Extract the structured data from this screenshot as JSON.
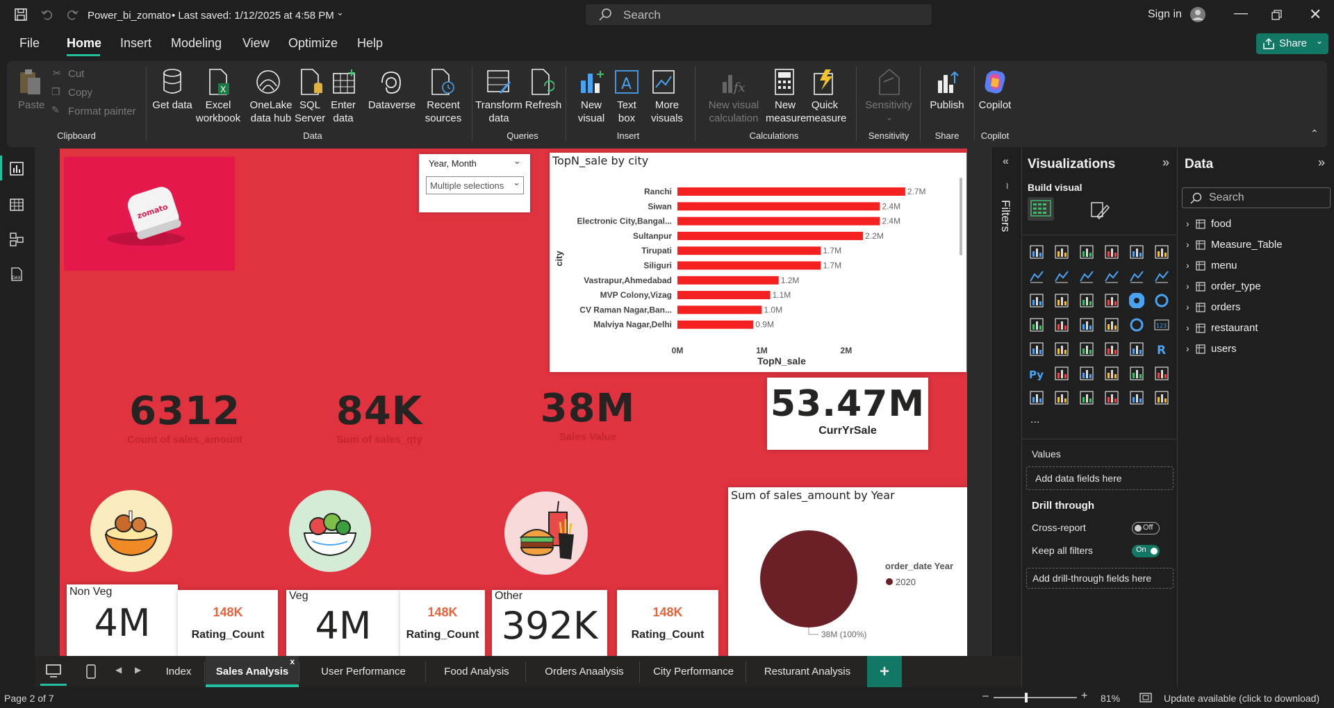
{
  "titlebar": {
    "title": "Power_bi_zomato",
    "saved": "• Last saved: 1/12/2025 at 4:58 PM",
    "search_placeholder": "Search",
    "sign_in": "Sign in"
  },
  "menu": {
    "items": [
      "File",
      "Home",
      "Insert",
      "Modeling",
      "View",
      "Optimize",
      "Help"
    ],
    "active": "Home",
    "share": "Share"
  },
  "ribbon": {
    "clipboard": {
      "paste": "Paste",
      "cut": "Cut",
      "copy": "Copy",
      "format_painter": "Format painter",
      "group": "Clipboard"
    },
    "data": {
      "items": [
        "Get data",
        "Excel workbook",
        "OneLake data hub",
        "SQL Server",
        "Enter data",
        "Dataverse",
        "Recent sources"
      ],
      "group": "Data"
    },
    "queries": {
      "items": [
        "Transform data",
        "Refresh"
      ],
      "group": "Queries"
    },
    "insert": {
      "items": [
        "New visual",
        "Text box",
        "More visuals"
      ],
      "group": "Insert"
    },
    "calculations": {
      "items": [
        "New visual calculation",
        "New measure",
        "Quick measure"
      ],
      "group": "Calculations"
    },
    "sensitivity": {
      "items": [
        "Sensitivity"
      ],
      "group": "Sensitivity"
    },
    "share": {
      "items": [
        "Publish"
      ],
      "group": "Share"
    },
    "copilot": {
      "items": [
        "Copilot"
      ],
      "group": "Copilot"
    }
  },
  "slicer": {
    "title": "Year, Month",
    "value": "Multiple selections"
  },
  "logo_text": "zomato",
  "kpis": [
    {
      "value": "6312",
      "label": "Count of sales_amount"
    },
    {
      "value": "84K",
      "label": "Sum of sales_qty"
    },
    {
      "value": "38M",
      "label": "Sales Value"
    },
    {
      "value": "53.47M",
      "label": "CurrYrSale"
    }
  ],
  "category_cards": [
    {
      "title": "Non Veg",
      "value": "4M",
      "rating": "148K",
      "rating_label": "Rating_Count"
    },
    {
      "title": "Veg",
      "value": "4M",
      "rating": "148K",
      "rating_label": "Rating_Count"
    },
    {
      "title": "Other",
      "value": "392K",
      "rating": "148K",
      "rating_label": "Rating_Count"
    }
  ],
  "chart_data": [
    {
      "type": "bar",
      "title": "TopN_sale by city",
      "xlabel": "TopN_sale",
      "ylabel": "city",
      "categories": [
        "Ranchi",
        "Siwan",
        "Electronic City,Bangal...",
        "Sultanpur",
        "Tirupati",
        "Siliguri",
        "Vastrapur,Ahmedabad",
        "MVP Colony,Vizag",
        "CV Raman Nagar,Ban...",
        "Malviya Nagar,Delhi"
      ],
      "values": [
        2.7,
        2.4,
        2.4,
        2.2,
        1.7,
        1.7,
        1.2,
        1.1,
        1.0,
        0.9
      ],
      "data_labels": [
        "2.7M",
        "2.4M",
        "2.4M",
        "2.2M",
        "1.7M",
        "1.7M",
        "1.2M",
        "1.1M",
        "1.0M",
        "0.9M"
      ],
      "xticks": [
        "0M",
        "1M",
        "2M"
      ],
      "xlim": [
        0,
        2.8
      ],
      "color": "#f52020"
    },
    {
      "type": "pie",
      "title": "Sum of sales_amount by Year",
      "legend_title": "order_date Year",
      "categories": [
        "2020"
      ],
      "values": [
        38
      ],
      "data_label": "38M (100%)",
      "color": "#6b1f26",
      "legend_position": "right"
    }
  ],
  "filters": {
    "label": "Filters"
  },
  "visualizations": {
    "title": "Visualizations",
    "build_visual": "Build visual",
    "values": "Values",
    "add_fields": "Add data fields here",
    "drill_through": "Drill through",
    "cross_report": "Cross-report",
    "cross_state": "Off",
    "keep_filters": "Keep all filters",
    "keep_state": "On",
    "add_drill": "Add drill-through fields here",
    "more": "..."
  },
  "data_pane": {
    "title": "Data",
    "search_placeholder": "Search",
    "tables": [
      "food",
      "Measure_Table",
      "menu",
      "order_type",
      "orders",
      "restaurant",
      "users"
    ]
  },
  "tabs": {
    "items": [
      "Index",
      "Sales Analysis",
      "User Performance",
      "Food Analysis",
      "Orders Anaalysis",
      "City Performance",
      "Resturant Analysis"
    ],
    "active": "Sales Analysis",
    "add": "+",
    "close": "x"
  },
  "status": {
    "page": "Page 2 of 7",
    "zoom": "81%",
    "update": "Update available (click to download)"
  },
  "colors": {
    "canvas": "#e0333f",
    "accent": "#117865",
    "bar": "#f52020",
    "pie": "#6b1f26"
  }
}
